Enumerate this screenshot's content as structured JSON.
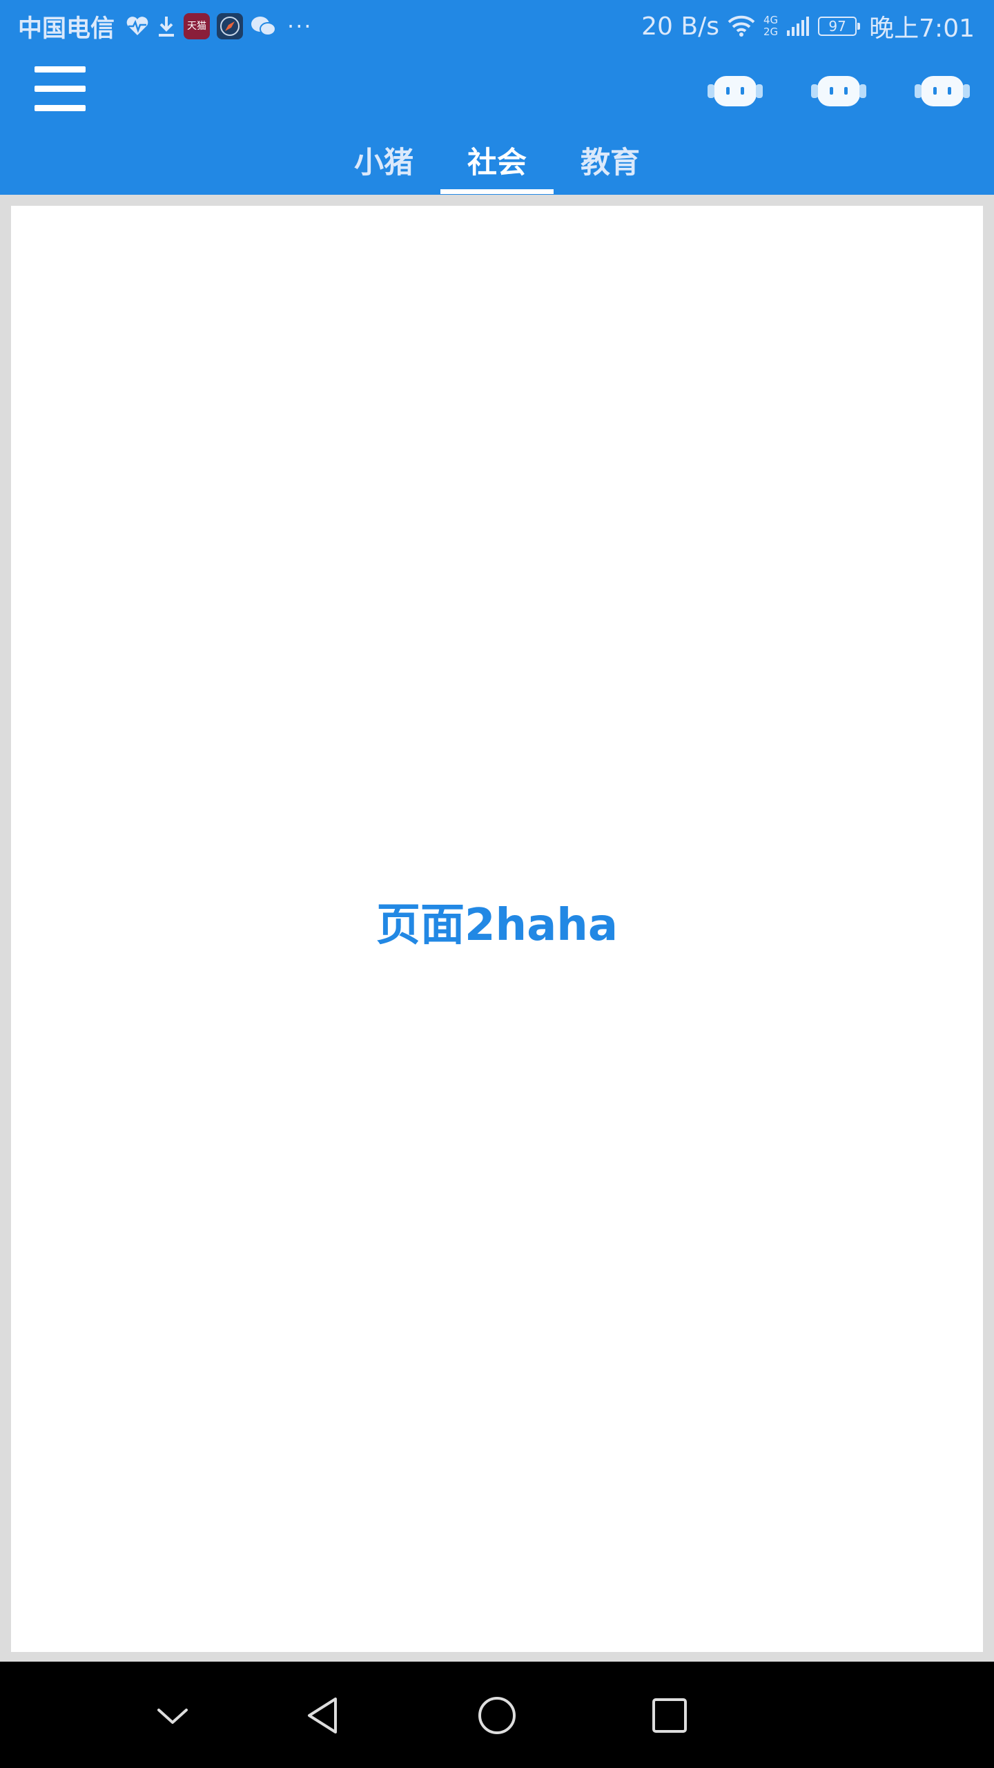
{
  "status_bar": {
    "carrier": "中国电信",
    "icons": [
      "heart-rate-icon",
      "download-icon",
      "tmall-app-icon",
      "compass-app-icon",
      "wechat-icon"
    ],
    "tmall_label": "天猫",
    "more": "···",
    "network_speed": "20 B/s",
    "network_type_top": "4G",
    "network_type_bottom": "2G",
    "battery_level": "97",
    "time": "晚上7:01"
  },
  "toolbar": {
    "menu_icon": "hamburger-menu-icon",
    "action_icons": [
      "robot-face-icon",
      "robot-face-icon",
      "robot-face-icon"
    ]
  },
  "tabs": {
    "items": [
      {
        "label": "小猪"
      },
      {
        "label": "社会"
      },
      {
        "label": "教育"
      }
    ],
    "selected": "社会"
  },
  "main": {
    "page_text": "页面2haha"
  },
  "colors": {
    "primary": "#2288e4",
    "chrome_text": "#dbe9fb",
    "page_background": "#dcdcdc",
    "nav_bar": "#000000"
  },
  "nav_bar": {
    "buttons": [
      "collapse-icon",
      "back-icon",
      "home-icon",
      "recents-icon"
    ]
  }
}
